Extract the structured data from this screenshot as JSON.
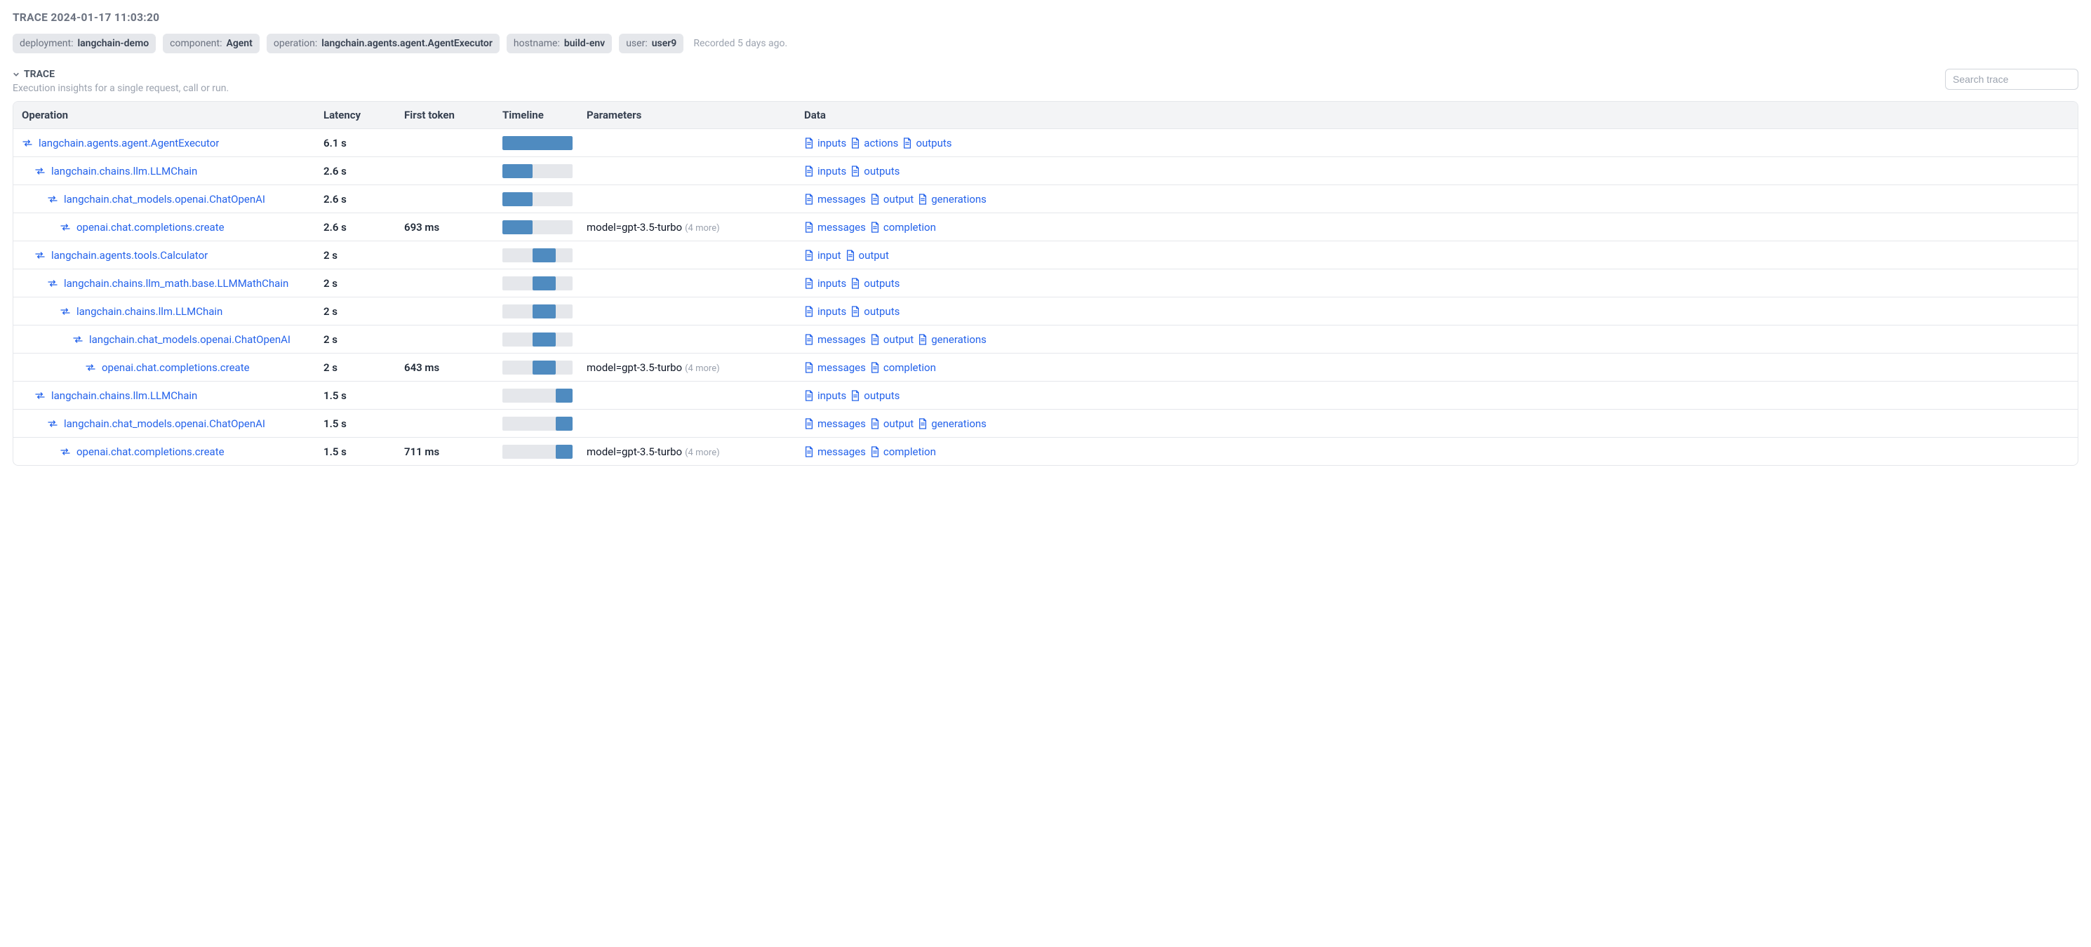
{
  "header": {
    "title": "TRACE 2024-01-17 11:03:20",
    "tags": [
      {
        "key": "deployment:",
        "value": "langchain-demo"
      },
      {
        "key": "component:",
        "value": "Agent"
      },
      {
        "key": "operation:",
        "value": "langchain.agents.agent.AgentExecutor"
      },
      {
        "key": "hostname:",
        "value": "build-env"
      },
      {
        "key": "user:",
        "value": "user9"
      }
    ],
    "recorded": "Recorded 5 days ago."
  },
  "section": {
    "title": "TRACE",
    "subtitle": "Execution insights for a single request, call or run.",
    "search_placeholder": "Search trace"
  },
  "table": {
    "headers": {
      "operation": "Operation",
      "latency": "Latency",
      "first_token": "First token",
      "timeline": "Timeline",
      "parameters": "Parameters",
      "data": "Data"
    },
    "rows": [
      {
        "indent": 0,
        "operation": "langchain.agents.agent.AgentExecutor",
        "latency": "6.1 s",
        "first_token": "",
        "timeline": {
          "start": 0,
          "width": 100
        },
        "params": "",
        "params_more": "",
        "data": [
          "inputs",
          "actions",
          "outputs"
        ]
      },
      {
        "indent": 1,
        "operation": "langchain.chains.llm.LLMChain",
        "latency": "2.6 s",
        "first_token": "",
        "timeline": {
          "start": 0,
          "width": 43
        },
        "params": "",
        "params_more": "",
        "data": [
          "inputs",
          "outputs"
        ]
      },
      {
        "indent": 2,
        "operation": "langchain.chat_models.openai.ChatOpenAI",
        "latency": "2.6 s",
        "first_token": "",
        "timeline": {
          "start": 0,
          "width": 43
        },
        "params": "",
        "params_more": "",
        "data": [
          "messages",
          "output",
          "generations"
        ]
      },
      {
        "indent": 3,
        "operation": "openai.chat.completions.create",
        "latency": "2.6 s",
        "first_token": "693 ms",
        "timeline": {
          "start": 0,
          "width": 43
        },
        "params": "model=gpt-3.5-turbo",
        "params_more": "(4 more)",
        "data": [
          "messages",
          "completion"
        ]
      },
      {
        "indent": 1,
        "operation": "langchain.agents.tools.Calculator",
        "latency": "2 s",
        "first_token": "",
        "timeline": {
          "start": 43,
          "width": 33
        },
        "params": "",
        "params_more": "",
        "data": [
          "input",
          "output"
        ]
      },
      {
        "indent": 2,
        "operation": "langchain.chains.llm_math.base.LLMMathChain",
        "latency": "2 s",
        "first_token": "",
        "timeline": {
          "start": 43,
          "width": 33
        },
        "params": "",
        "params_more": "",
        "data": [
          "inputs",
          "outputs"
        ]
      },
      {
        "indent": 3,
        "operation": "langchain.chains.llm.LLMChain",
        "latency": "2 s",
        "first_token": "",
        "timeline": {
          "start": 43,
          "width": 33
        },
        "params": "",
        "params_more": "",
        "data": [
          "inputs",
          "outputs"
        ]
      },
      {
        "indent": 4,
        "operation": "langchain.chat_models.openai.ChatOpenAI",
        "latency": "2 s",
        "first_token": "",
        "timeline": {
          "start": 43,
          "width": 33
        },
        "params": "",
        "params_more": "",
        "data": [
          "messages",
          "output",
          "generations"
        ]
      },
      {
        "indent": 5,
        "operation": "openai.chat.completions.create",
        "latency": "2 s",
        "first_token": "643 ms",
        "timeline": {
          "start": 43,
          "width": 33
        },
        "params": "model=gpt-3.5-turbo",
        "params_more": "(4 more)",
        "data": [
          "messages",
          "completion"
        ]
      },
      {
        "indent": 1,
        "operation": "langchain.chains.llm.LLMChain",
        "latency": "1.5 s",
        "first_token": "",
        "timeline": {
          "start": 76,
          "width": 24
        },
        "params": "",
        "params_more": "",
        "data": [
          "inputs",
          "outputs"
        ]
      },
      {
        "indent": 2,
        "operation": "langchain.chat_models.openai.ChatOpenAI",
        "latency": "1.5 s",
        "first_token": "",
        "timeline": {
          "start": 76,
          "width": 24
        },
        "params": "",
        "params_more": "",
        "data": [
          "messages",
          "output",
          "generations"
        ]
      },
      {
        "indent": 3,
        "operation": "openai.chat.completions.create",
        "latency": "1.5 s",
        "first_token": "711 ms",
        "timeline": {
          "start": 76,
          "width": 24
        },
        "params": "model=gpt-3.5-turbo",
        "params_more": "(4 more)",
        "data": [
          "messages",
          "completion"
        ]
      }
    ]
  }
}
